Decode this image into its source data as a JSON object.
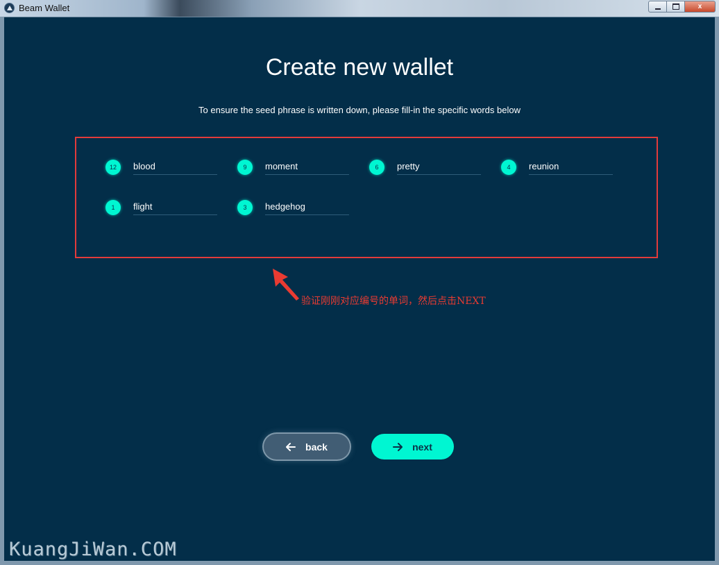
{
  "window": {
    "title": "Beam Wallet",
    "close_glyph": "x"
  },
  "page": {
    "title": "Create new wallet",
    "subtitle": "To ensure the seed phrase is written down, please fill-in the specific words below"
  },
  "words": [
    {
      "index": "12",
      "value": "blood"
    },
    {
      "index": "9",
      "value": "moment"
    },
    {
      "index": "6",
      "value": "pretty"
    },
    {
      "index": "4",
      "value": "reunion"
    },
    {
      "index": "1",
      "value": "flight"
    },
    {
      "index": "3",
      "value": "hedgehog"
    }
  ],
  "annotation": {
    "text": "验证刚刚对应编号的单词，然后点击NEXT",
    "color": "#e83b32"
  },
  "buttons": {
    "back_label": "back",
    "next_label": "next"
  },
  "watermark": "KuangJiWan.COM",
  "colors": {
    "background": "#032e49",
    "accent": "#00f6d2",
    "highlight_border": "#e33b3b"
  }
}
